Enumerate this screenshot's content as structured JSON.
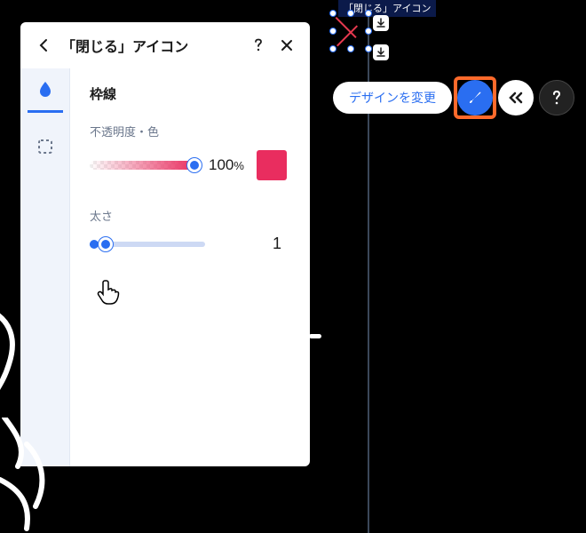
{
  "object_label": "「閉じる」アイコン",
  "toolbar": {
    "design_change": "デザインを変更"
  },
  "panel": {
    "title": "「閉じる」アイコン",
    "section": "枠線",
    "opacity_label": "不透明度・色",
    "opacity_value": "100",
    "opacity_unit": "%",
    "thickness_label": "太さ",
    "thickness_value": "1"
  }
}
